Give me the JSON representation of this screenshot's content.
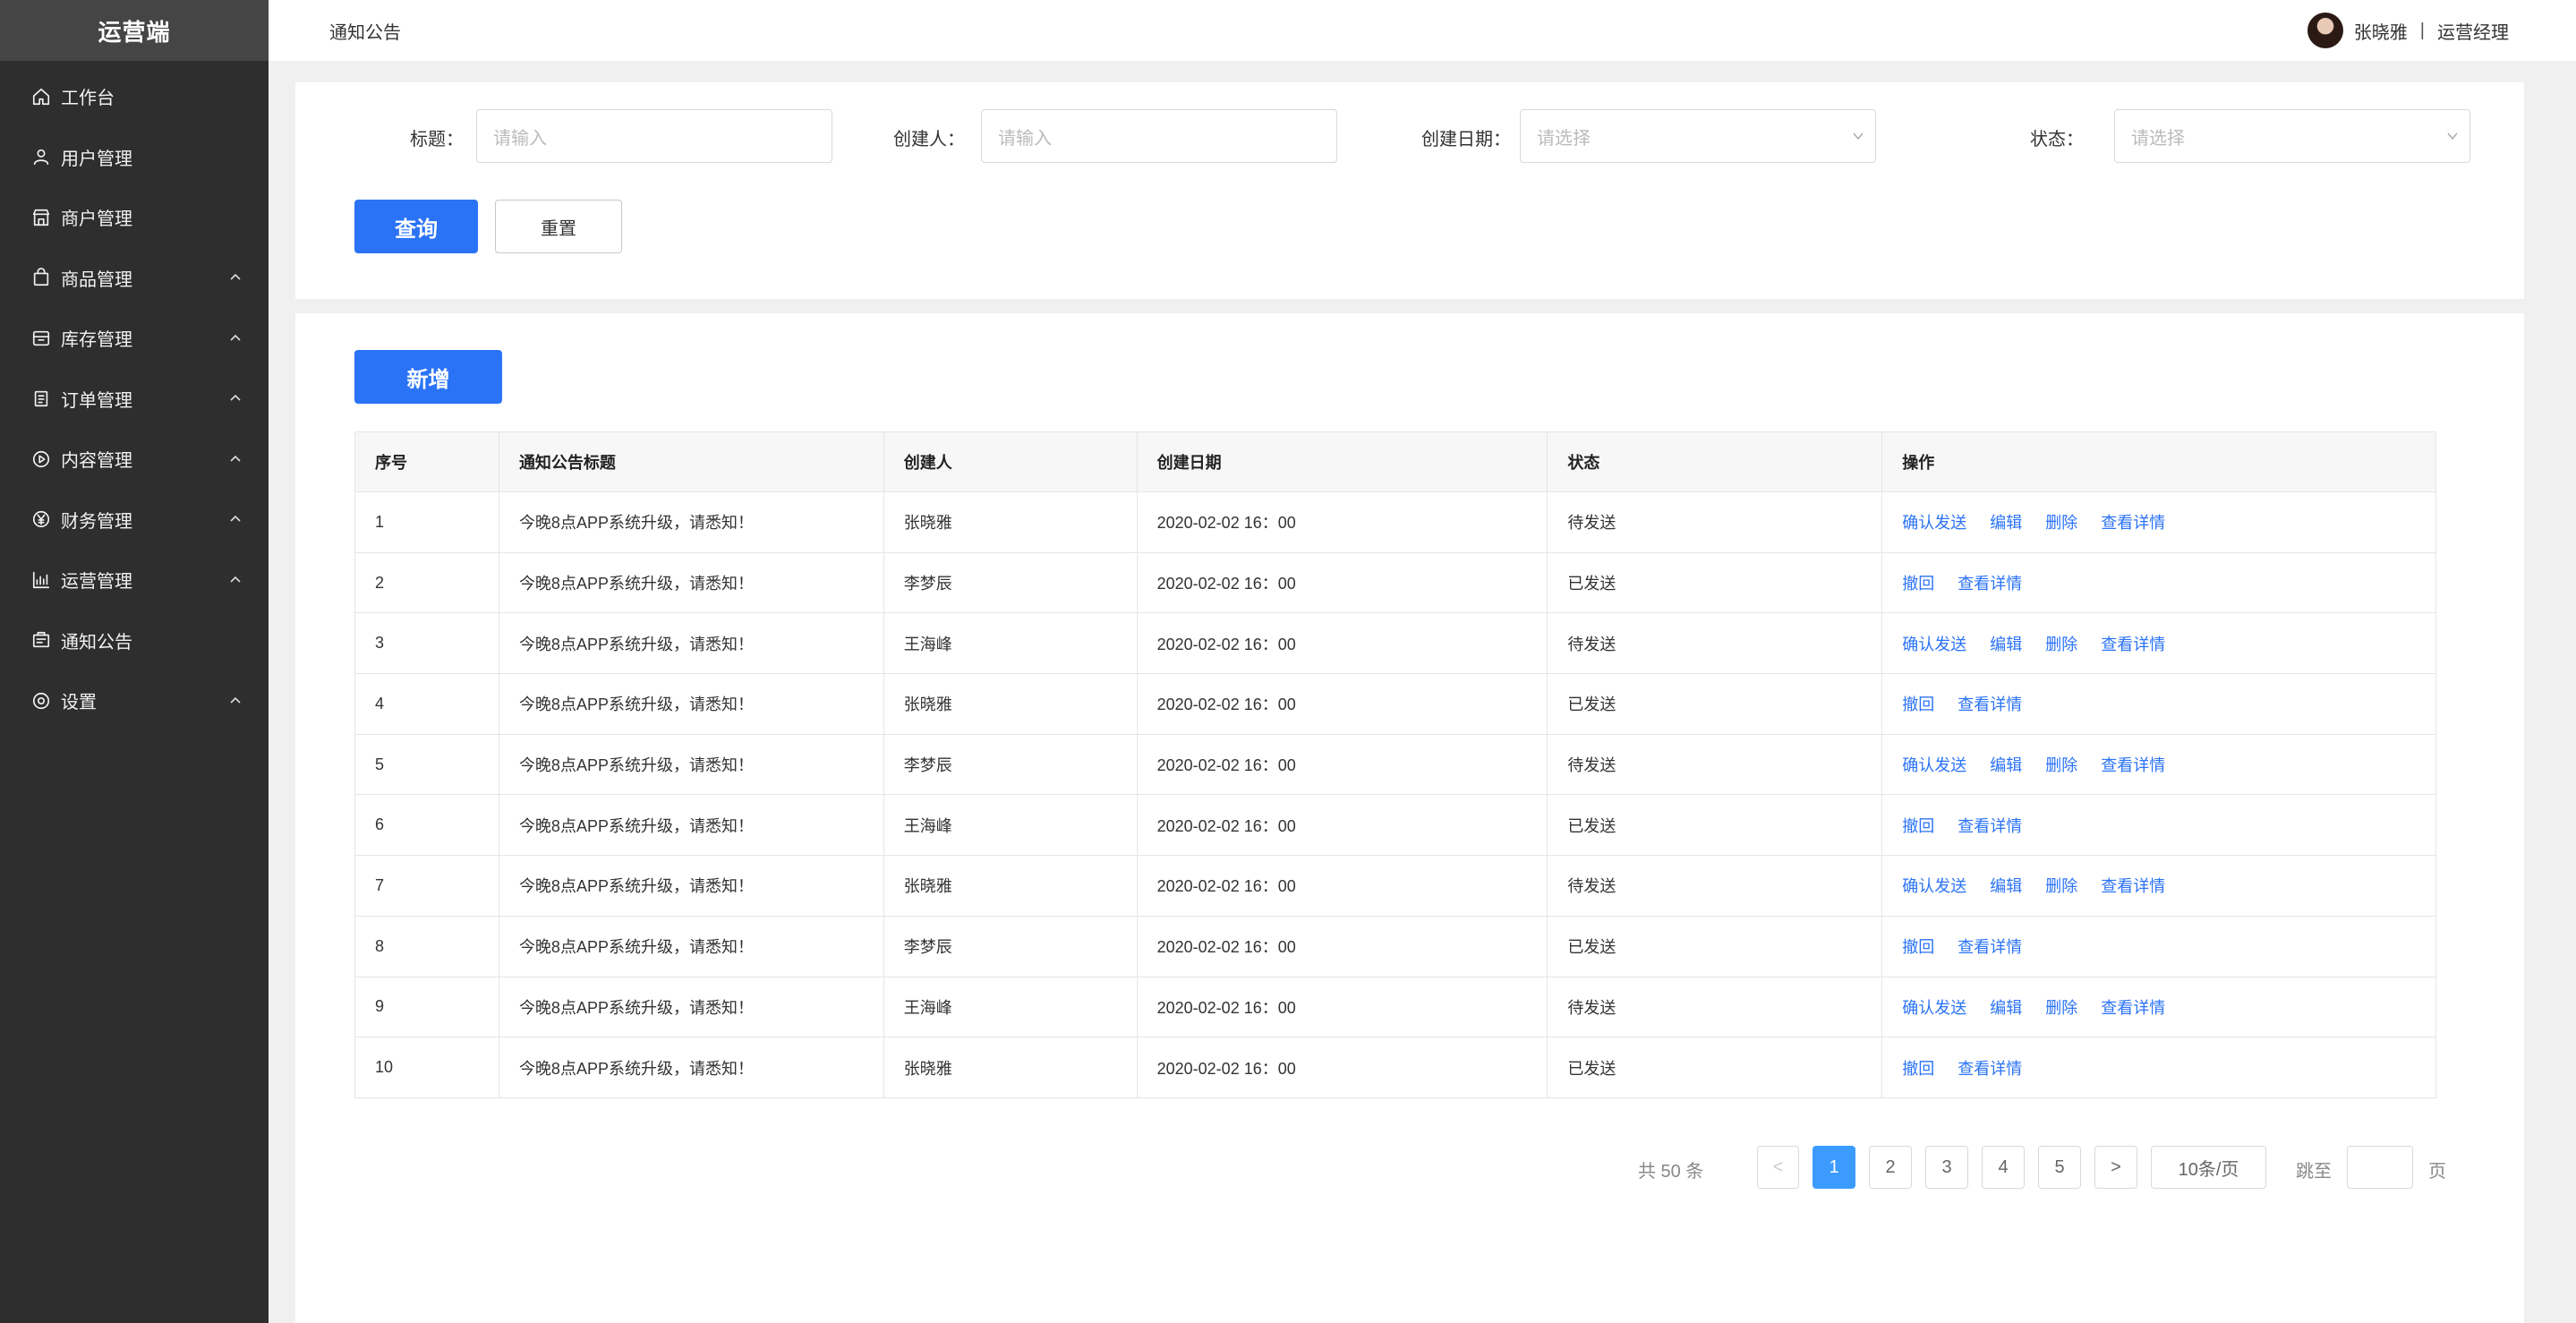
{
  "app": {
    "brand": "运营端"
  },
  "sidebar": {
    "items": [
      {
        "label": "工作台",
        "icon": "home-icon",
        "expandable": false
      },
      {
        "label": "用户管理",
        "icon": "user-icon",
        "expandable": false
      },
      {
        "label": "商户管理",
        "icon": "store-icon",
        "expandable": false
      },
      {
        "label": "商品管理",
        "icon": "bag-icon",
        "expandable": true
      },
      {
        "label": "库存管理",
        "icon": "box-icon",
        "expandable": true
      },
      {
        "label": "订单管理",
        "icon": "clipboard-icon",
        "expandable": true
      },
      {
        "label": "内容管理",
        "icon": "play-icon",
        "expandable": true
      },
      {
        "label": "财务管理",
        "icon": "yen-icon",
        "expandable": true
      },
      {
        "label": "运营管理",
        "icon": "chart-icon",
        "expandable": true
      },
      {
        "label": "通知公告",
        "icon": "notice-icon",
        "expandable": false
      },
      {
        "label": "设置",
        "icon": "settings-icon",
        "expandable": true
      }
    ]
  },
  "header": {
    "title": "通知公告",
    "user": {
      "name": "张晓雅",
      "separator": "|",
      "role": "运营经理"
    }
  },
  "filters": {
    "title_label": "标题：",
    "title_placeholder": "请输入",
    "creator_label": "创建人：",
    "creator_placeholder": "请输入",
    "date_label": "创建日期：",
    "date_placeholder": "请选择",
    "status_label": "状态：",
    "status_placeholder": "请选择",
    "query_button": "查询",
    "reset_button": "重置"
  },
  "toolbar": {
    "add_button": "新增"
  },
  "table": {
    "columns": [
      "序号",
      "通知公告标题",
      "创建人",
      "创建日期",
      "状态",
      "操作"
    ],
    "rows": [
      {
        "no": "1",
        "title": "今晚8点APP系统升级，请悉知！",
        "creator": "张晓雅",
        "date": "2020-02-02 16：00",
        "status": "待发送",
        "actions": [
          "确认发送",
          "编辑",
          "删除",
          "查看详情"
        ]
      },
      {
        "no": "2",
        "title": "今晚8点APP系统升级，请悉知！",
        "creator": "李梦辰",
        "date": "2020-02-02 16：00",
        "status": "已发送",
        "actions": [
          "撤回",
          "查看详情"
        ]
      },
      {
        "no": "3",
        "title": "今晚8点APP系统升级，请悉知！",
        "creator": "王海峰",
        "date": "2020-02-02 16：00",
        "status": "待发送",
        "actions": [
          "确认发送",
          "编辑",
          "删除",
          "查看详情"
        ]
      },
      {
        "no": "4",
        "title": "今晚8点APP系统升级，请悉知！",
        "creator": "张晓雅",
        "date": "2020-02-02 16：00",
        "status": "已发送",
        "actions": [
          "撤回",
          "查看详情"
        ]
      },
      {
        "no": "5",
        "title": "今晚8点APP系统升级，请悉知！",
        "creator": "李梦辰",
        "date": "2020-02-02 16：00",
        "status": "待发送",
        "actions": [
          "确认发送",
          "编辑",
          "删除",
          "查看详情"
        ]
      },
      {
        "no": "6",
        "title": "今晚8点APP系统升级，请悉知！",
        "creator": "王海峰",
        "date": "2020-02-02 16：00",
        "status": "已发送",
        "actions": [
          "撤回",
          "查看详情"
        ]
      },
      {
        "no": "7",
        "title": "今晚8点APP系统升级，请悉知！",
        "creator": "张晓雅",
        "date": "2020-02-02 16：00",
        "status": "待发送",
        "actions": [
          "确认发送",
          "编辑",
          "删除",
          "查看详情"
        ]
      },
      {
        "no": "8",
        "title": "今晚8点APP系统升级，请悉知！",
        "creator": "李梦辰",
        "date": "2020-02-02 16：00",
        "status": "已发送",
        "actions": [
          "撤回",
          "查看详情"
        ]
      },
      {
        "no": "9",
        "title": "今晚8点APP系统升级，请悉知！",
        "creator": "王海峰",
        "date": "2020-02-02 16：00",
        "status": "待发送",
        "actions": [
          "确认发送",
          "编辑",
          "删除",
          "查看详情"
        ]
      },
      {
        "no": "10",
        "title": "今晚8点APP系统升级，请悉知！",
        "creator": "张晓雅",
        "date": "2020-02-02 16：00",
        "status": "已发送",
        "actions": [
          "撤回",
          "查看详情"
        ]
      }
    ]
  },
  "pagination": {
    "total": "共 50 条",
    "prev": "<",
    "pages": [
      "1",
      "2",
      "3",
      "4",
      "5"
    ],
    "current": "1",
    "next": ">",
    "page_size": "10条/页",
    "jump_label": "跳至",
    "page_suffix": "页"
  },
  "colors": {
    "primary": "#2b73f6",
    "sidebar_bg": "#2e2e2e",
    "brand_bg": "#454545",
    "pager_active": "#3b9bff"
  }
}
